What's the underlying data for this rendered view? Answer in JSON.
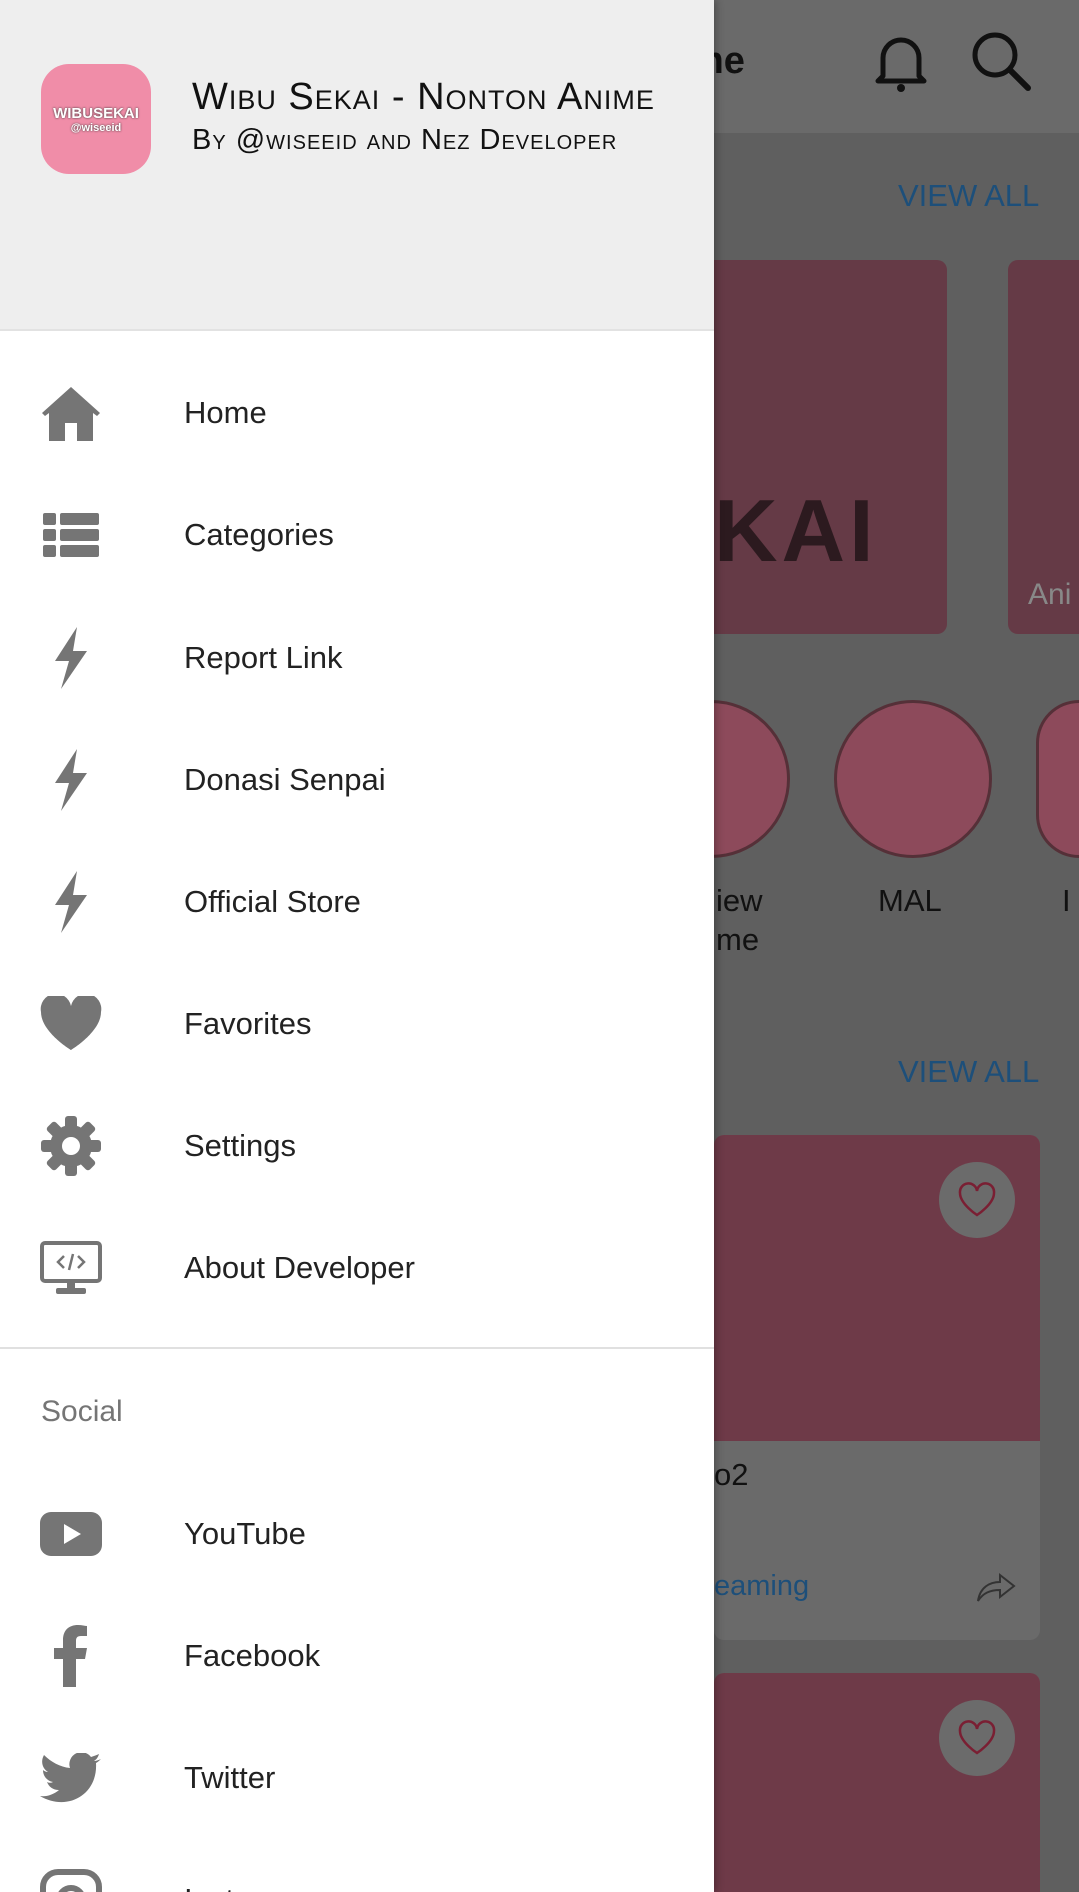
{
  "background": {
    "title_fragment": "me",
    "view_all_1": "VIEW ALL",
    "view_all_2": "VIEW ALL",
    "banner_text_1": "KAI",
    "banner_text_2": "Ani",
    "circle_label_1a": "iew",
    "circle_label_1b": "me",
    "circle_label_2": "MAL",
    "circle_label_3": "I",
    "card_title": "o2",
    "card_link": "eaming",
    "logo_text": "WIBUSEKAI"
  },
  "drawer": {
    "app_title": "Wibu Sekai - Nonton Anime",
    "app_subtitle": "By @wiseeid and Nez Developer",
    "logo_text": "WIBUSEKAI",
    "logo_sub": "@wiseeid",
    "items": [
      {
        "label": "Home",
        "icon": "home-icon"
      },
      {
        "label": "Categories",
        "icon": "list-icon"
      },
      {
        "label": "Report Link",
        "icon": "bolt-icon"
      },
      {
        "label": "Donasi Senpai",
        "icon": "bolt-icon"
      },
      {
        "label": "Official Store",
        "icon": "bolt-icon"
      },
      {
        "label": "Favorites",
        "icon": "heart-icon"
      },
      {
        "label": "Settings",
        "icon": "gear-icon"
      },
      {
        "label": "About Developer",
        "icon": "monitor-code-icon"
      }
    ],
    "social_header": "Social",
    "social": [
      {
        "label": "YouTube",
        "icon": "youtube-icon"
      },
      {
        "label": "Facebook",
        "icon": "facebook-icon"
      },
      {
        "label": "Twitter",
        "icon": "twitter-icon"
      },
      {
        "label": "Instagram",
        "icon": "instagram-icon"
      }
    ]
  },
  "colors": {
    "icon": "#757575",
    "link": "#1d4f7a",
    "header_bg": "#eeeeee"
  }
}
